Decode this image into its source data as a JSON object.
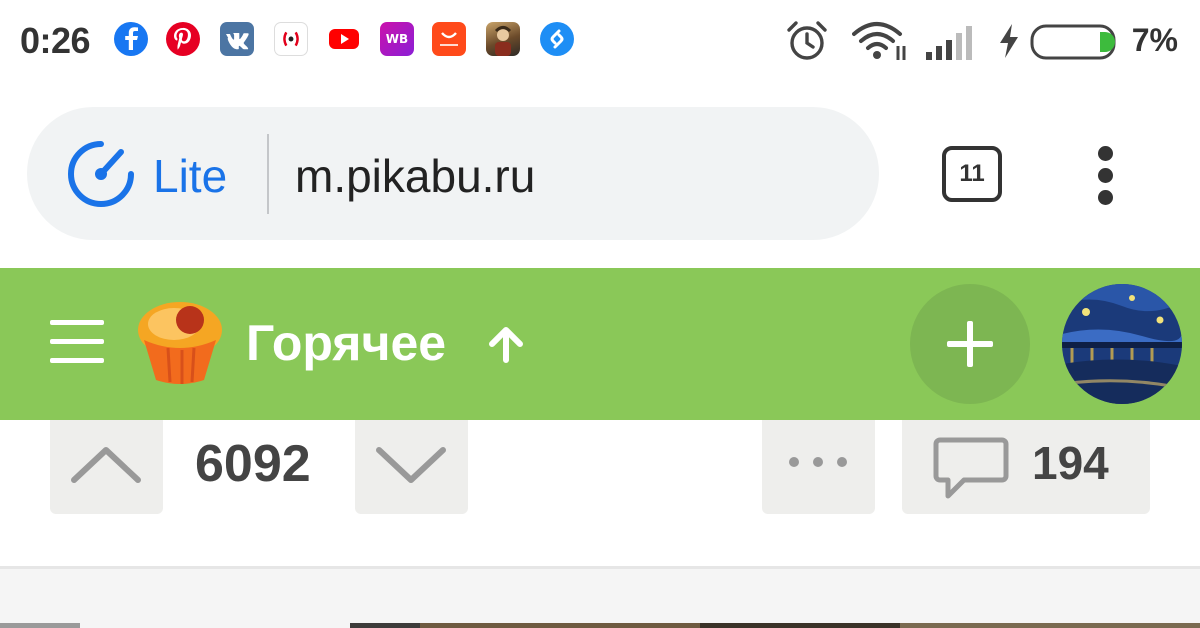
{
  "status_bar": {
    "time": "0:26",
    "notifications": [
      "facebook-icon",
      "pinterest-icon",
      "vk-icon",
      "radio-icon",
      "youtube-icon",
      "wildberries-icon",
      "aliexpress-icon",
      "game-icon",
      "shazam-icon"
    ],
    "wildberries_label": "WB",
    "battery_percent": "7%"
  },
  "browser": {
    "lite_label": "Lite",
    "url": "m.pikabu.ru",
    "tab_count": "11",
    "accent_color": "#1a73e8"
  },
  "header": {
    "title": "Горячее",
    "brand_color": "#8ac858"
  },
  "post": {
    "rating": "6092",
    "comments_count": "194"
  }
}
